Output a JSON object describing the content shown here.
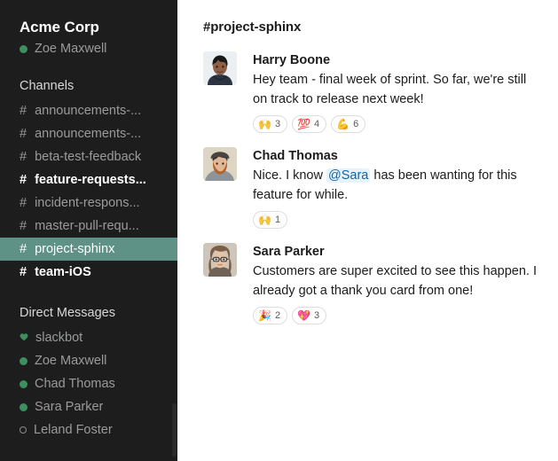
{
  "sidebar": {
    "workspace_name": "Acme Corp",
    "current_user": "Zoe Maxwell",
    "current_user_presence": "online",
    "channels_header": "Channels",
    "dms_header": "Direct Messages",
    "hash": "#",
    "channels": [
      {
        "label": "announcements-...",
        "state": "read"
      },
      {
        "label": "announcements-...",
        "state": "read"
      },
      {
        "label": "beta-test-feedback",
        "state": "read"
      },
      {
        "label": "feature-requests...",
        "state": "unread"
      },
      {
        "label": "incident-respons...",
        "state": "read"
      },
      {
        "label": "master-pull-requ...",
        "state": "read"
      },
      {
        "label": "project-sphinx",
        "state": "active"
      },
      {
        "label": "team-iOS",
        "state": "unread"
      }
    ],
    "dms": [
      {
        "label": "slackbot",
        "presence": "heart"
      },
      {
        "label": "Zoe Maxwell",
        "presence": "online"
      },
      {
        "label": "Chad Thomas",
        "presence": "online"
      },
      {
        "label": "Sara Parker",
        "presence": "online"
      },
      {
        "label": "Leland Foster",
        "presence": "away"
      }
    ]
  },
  "main": {
    "channel_title": "#project-sphinx",
    "messages": [
      {
        "author": "Harry Boone",
        "avatar": "harry-boone-avatar",
        "text_before": "Hey team - final week of sprint. So far, we're still on track to release next week!",
        "mention": "",
        "text_after": "",
        "reactions": [
          {
            "emoji": "🙌",
            "name": "raised-hands-emoji",
            "count": "3"
          },
          {
            "emoji": "💯",
            "name": "hundred-points-emoji",
            "count": "4"
          },
          {
            "emoji": "💪",
            "name": "flexed-biceps-emoji",
            "count": "6"
          }
        ]
      },
      {
        "author": "Chad Thomas",
        "avatar": "chad-thomas-avatar",
        "text_before": "Nice. I know ",
        "mention": "@Sara",
        "text_after": " has been wanting for this feature for while.",
        "reactions": [
          {
            "emoji": "🙌",
            "name": "raised-hands-emoji",
            "count": "1"
          }
        ]
      },
      {
        "author": "Sara Parker",
        "avatar": "sara-parker-avatar",
        "text_before": "Customers are super excited to see this happen. I already got a thank you card from one!",
        "mention": "",
        "text_after": "",
        "reactions": [
          {
            "emoji": "🎉",
            "name": "party-popper-emoji",
            "count": "2"
          },
          {
            "emoji": "💖",
            "name": "sparkling-heart-emoji",
            "count": "3"
          }
        ]
      }
    ]
  },
  "colors": {
    "sidebar_bg": "#1d1d1d",
    "active_channel_bg": "#5f9287",
    "presence_online": "#3d8f5f",
    "mention_text": "#1264a3",
    "mention_bg": "#e8f2fb",
    "text_primary": "#1d1c1d",
    "text_muted": "#9a9b9c"
  }
}
